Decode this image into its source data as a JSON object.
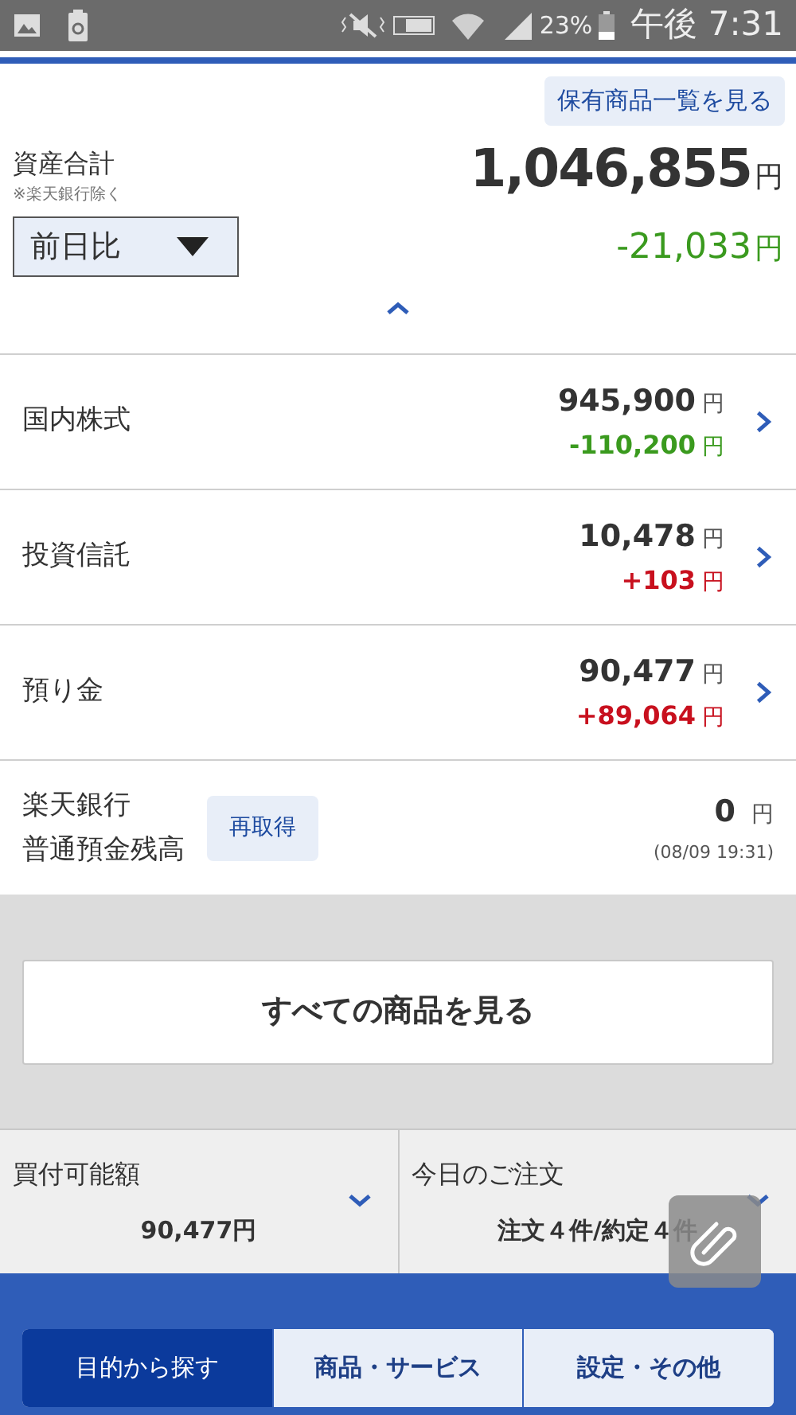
{
  "status_bar": {
    "battery": "23%",
    "time": "午後 7:31"
  },
  "summary": {
    "link": "保有商品一覧を見る",
    "label": "資産合計",
    "note": "※楽天銀行除く",
    "value": "1,046,855",
    "unit": "円",
    "compare": "前日比",
    "change": "-21,033",
    "change_unit": "円",
    "color": "#3a9a1e"
  },
  "holdings": [
    {
      "label": "国内株式",
      "value": "945,900",
      "unit": "円",
      "change": "-110,200",
      "change_unit": "円",
      "color": "#3a9a1e"
    },
    {
      "label": "投資信託",
      "value": "10,478",
      "unit": "円",
      "change": "+103",
      "change_unit": "円",
      "color": "#c8101e"
    },
    {
      "label": "預り金",
      "value": "90,477",
      "unit": "円",
      "change": "+89,064",
      "change_unit": "円",
      "color": "#c8101e"
    }
  ],
  "bank": {
    "label_lines": [
      "楽天銀行",
      "普通預金残高"
    ],
    "button": "再取得",
    "value": "0",
    "unit": "円",
    "timestamp": "(08/09 19:31)"
  },
  "all_products_button": "すべての商品を見る",
  "cards": [
    {
      "label": "買付可能額",
      "value": "90,477円"
    },
    {
      "label": "今日のご注文",
      "value": "注文４件/約定４件"
    }
  ],
  "nav_tabs": [
    {
      "label": "目的から探す",
      "selected": true
    },
    {
      "label": "商品・サービス",
      "selected": false
    },
    {
      "label": "設定・その他",
      "selected": false
    }
  ]
}
